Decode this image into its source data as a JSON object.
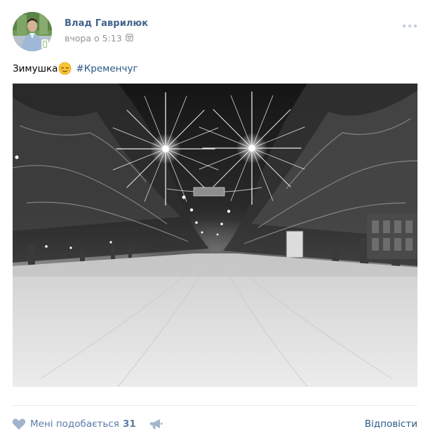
{
  "author": {
    "name": "Влад Гаврилюк",
    "time": "вчора о 5:13",
    "avatar_icon": "user-avatar",
    "online_icon": "mobile-online-icon"
  },
  "post": {
    "text": "Зимушка",
    "emoji": "relieved-face-emoji",
    "hashtag": "#Кременчуг",
    "photo": "night-winter-street-photo"
  },
  "actions": {
    "like_label": "Мені подобається",
    "like_count": "31",
    "share_icon": "megaphone-icon",
    "reply_label": "Відповісти"
  },
  "colors": {
    "name": "#42648b",
    "link": "#2a5885",
    "muted": "#939393",
    "action": "#5b7ba6",
    "divider": "#e7e8ec"
  }
}
